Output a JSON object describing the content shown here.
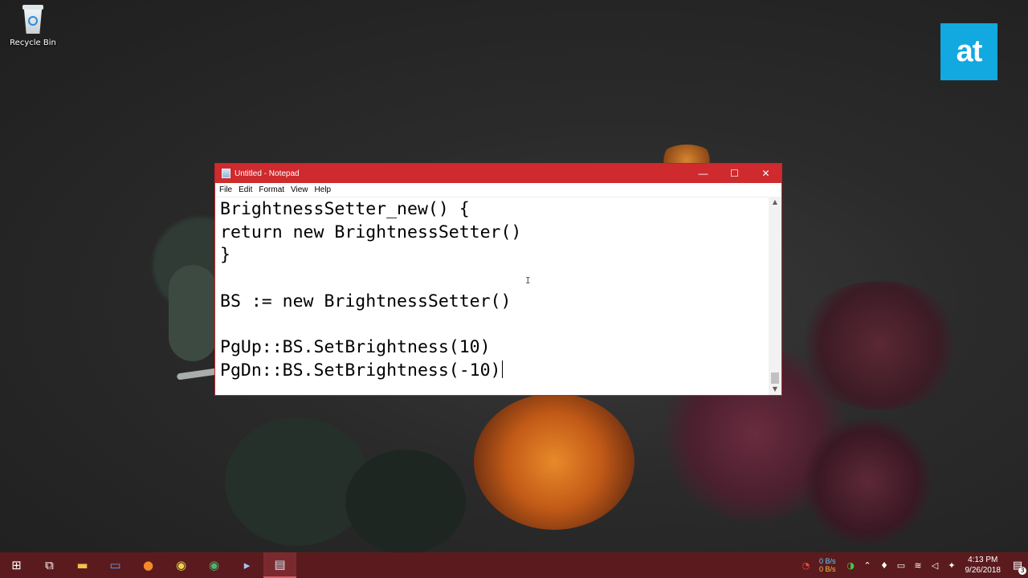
{
  "desktop": {
    "icons": [
      {
        "label": "Recycle Bin",
        "icon": "recycle-bin-icon"
      }
    ],
    "logo_text": "at",
    "accent_color": "#12a8e0"
  },
  "notepad": {
    "title": "Untitled - Notepad",
    "titlebar_color": "#cf2a2e",
    "controls": {
      "minimize": "—",
      "maximize": "☐",
      "close": "✕"
    },
    "menu": [
      "File",
      "Edit",
      "Format",
      "View",
      "Help"
    ],
    "lines": [
      "BrightnessSetter_new() {",
      "return new BrightnessSetter()",
      "}",
      "",
      "BS := new BrightnessSetter()",
      "",
      "PgUp::BS.SetBrightness(10)",
      "PgDn::BS.SetBrightness(-10)"
    ]
  },
  "taskbar": {
    "color": "#5b1b1e",
    "apps": [
      {
        "name": "start-icon",
        "glyph": "⊞"
      },
      {
        "name": "task-view-icon",
        "glyph": "⧉"
      },
      {
        "name": "file-explorer-icon",
        "glyph": "▬"
      },
      {
        "name": "pc-icon",
        "glyph": "▭"
      },
      {
        "name": "firefox-icon",
        "glyph": "●"
      },
      {
        "name": "chrome-icon",
        "glyph": "◉"
      },
      {
        "name": "chrome-alt-icon",
        "glyph": "◉"
      },
      {
        "name": "powershell-icon",
        "glyph": "▸"
      },
      {
        "name": "notepad-icon",
        "glyph": "▤"
      }
    ],
    "tray": {
      "net_up": "0 B/s",
      "net_down": "0 B/s",
      "time": "4:13 PM",
      "date": "9/26/2018",
      "notification_count": "3"
    }
  }
}
